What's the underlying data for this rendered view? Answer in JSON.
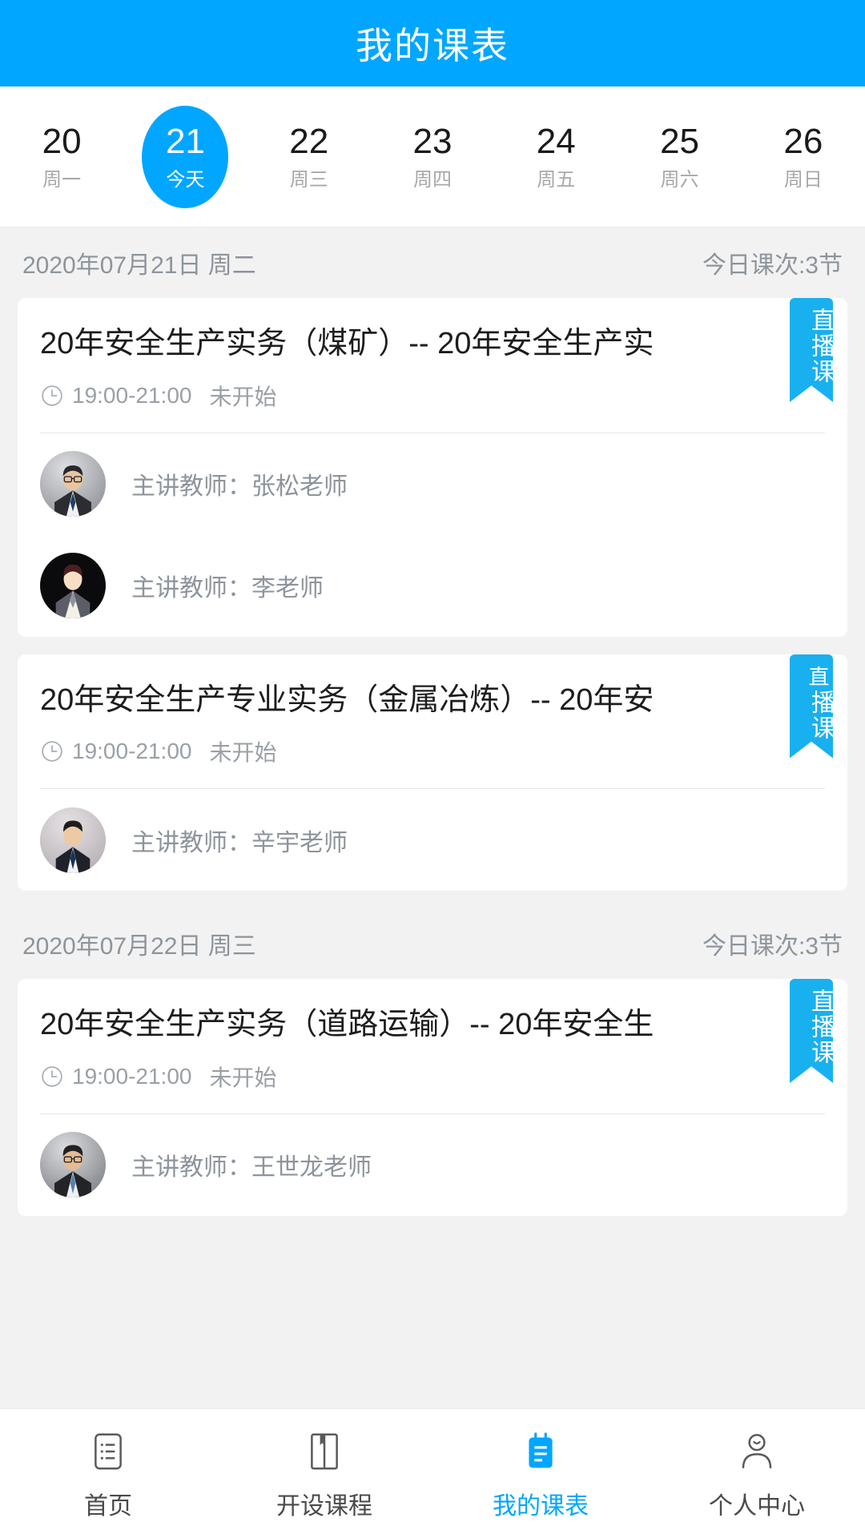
{
  "header": {
    "title": "我的课表",
    "background_color": "#00a6ff",
    "title_color": "#ffffff"
  },
  "week_strip": {
    "days": [
      {
        "num": "20",
        "label": "周一",
        "active": false
      },
      {
        "num": "21",
        "label": "今天",
        "active": true
      },
      {
        "num": "22",
        "label": "周三",
        "active": false
      },
      {
        "num": "23",
        "label": "周四",
        "active": false
      },
      {
        "num": "24",
        "label": "周五",
        "active": false
      },
      {
        "num": "25",
        "label": "周六",
        "active": false
      },
      {
        "num": "26",
        "label": "周日",
        "active": false
      }
    ]
  },
  "schedule": {
    "days": [
      {
        "date_label": "2020年07月21日 周二",
        "count_label": "今日课次:3节",
        "courses": [
          {
            "title": "20年安全生产实务（煤矿）-- 20年安全生产实",
            "time": "19:00-21:00",
            "status": "未开始",
            "badge": "直播课",
            "teachers": [
              {
                "name": "主讲教师：张松老师",
                "avatar": "photo-glasses-suit"
              },
              {
                "name": "主讲教师：李老师",
                "avatar": "illustration-dark-suit"
              }
            ]
          },
          {
            "title": "20年安全生产专业实务（金属冶炼）-- 20年安",
            "time": "19:00-21:00",
            "status": "未开始",
            "badge": "直播课",
            "teachers": [
              {
                "name": "主讲教师：辛宇老师",
                "avatar": "photo-young-suit"
              }
            ]
          }
        ]
      },
      {
        "date_label": "2020年07月22日 周三",
        "count_label": "今日课次:3节",
        "courses": [
          {
            "title": "20年安全生产实务（道路运输）-- 20年安全生",
            "time": "19:00-21:00",
            "status": "未开始",
            "badge": "直播课",
            "teachers": [
              {
                "name": "主讲教师：王世龙老师",
                "avatar": "photo-glasses-tie"
              }
            ]
          }
        ]
      }
    ],
    "clipped_badge": "直"
  },
  "bottom_nav": {
    "items": [
      {
        "label": "首页",
        "icon": "list-icon",
        "active": false
      },
      {
        "label": "开设课程",
        "icon": "book-icon",
        "active": false
      },
      {
        "label": "我的课表",
        "icon": "notepad-icon",
        "active": true
      },
      {
        "label": "个人中心",
        "icon": "person-icon",
        "active": false
      }
    ],
    "active_color": "#00a6ff",
    "inactive_color": "#4a4a4a"
  }
}
